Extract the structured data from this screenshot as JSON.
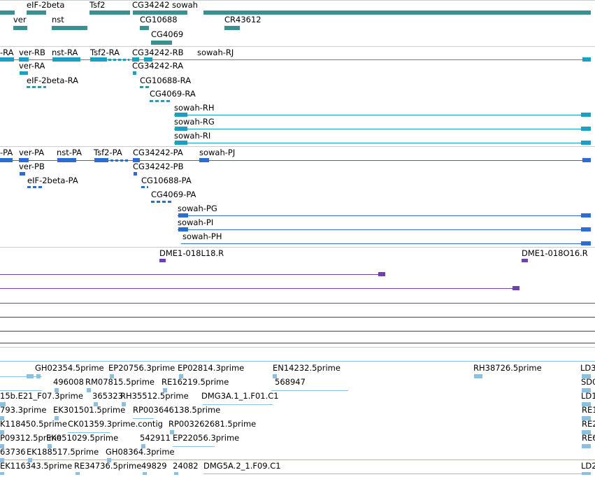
{
  "colors": {
    "gene": "#3a9090",
    "transcript": "#1aa0c0",
    "protein": "#2f6cd0",
    "reagent": "#7040b0",
    "est": "#8cc0e0",
    "separator": "#c8ced6"
  },
  "tracks": {
    "genes": {
      "labels": [
        "eIF-2beta",
        "Tsf2",
        "CG34242 sowah",
        "ver",
        "nst",
        "CG10688",
        "CR43612",
        "CG4069"
      ]
    },
    "transcripts": {
      "labels": [
        "-RA",
        "ver-RB",
        "nst-RA",
        "Tsf2-RA",
        "CG34242-RB",
        "sowah-RJ",
        "ver-RA",
        "CG34242-RA",
        "eIF-2beta-RA",
        "CG10688-RA",
        "CG4069-RA",
        "sowah-RH",
        "sowah-RG",
        "sowah-RI"
      ]
    },
    "proteins": {
      "labels": [
        "-PA",
        "ver-PA",
        "nst-PA",
        "Tsf2-PA",
        "CG34242-PA",
        "sowah-PJ",
        "ver-PB",
        "CG34242-PB",
        "eIF-2beta-PA",
        "CG10688-PA",
        "CG4069-PA",
        "sowah-PG",
        "sowah-PI",
        "sowah-PH"
      ]
    },
    "reagents": {
      "labels": [
        "DME1-018L18.R",
        "DME1-018O16.R"
      ]
    },
    "ests": {
      "labels": [
        "GH02354.5prime",
        "EP20756.3prime",
        "EP02814.3prime",
        "EN14232.5prime",
        "RH38726.5prime",
        "LD3",
        "496008",
        "RM07815.5prime",
        "RE16219.5prime",
        "568947",
        "SD0",
        "15b.E21_F07.3prime",
        "365323",
        "RH35512.5prime",
        "DMG3A.1_1.F01.C1",
        "LD1",
        "793.3prime",
        "EK301501.5prime",
        "RP003646138.5prime",
        "RE1",
        "K118450.5prime",
        "CK01359.3prime.contig",
        "RP003262681.5prime",
        "RE2",
        "P09312.5prime",
        "EK051029.5prime",
        "542911",
        "EP22056.3prime",
        "RE6",
        "63736",
        "EK188517.5prime",
        "GH08364.3prime",
        "EK116343.5prime",
        "RE34736.5prime",
        "49829",
        "24082",
        "DMG5A.2_1.F09.C1",
        "LD2"
      ]
    }
  }
}
